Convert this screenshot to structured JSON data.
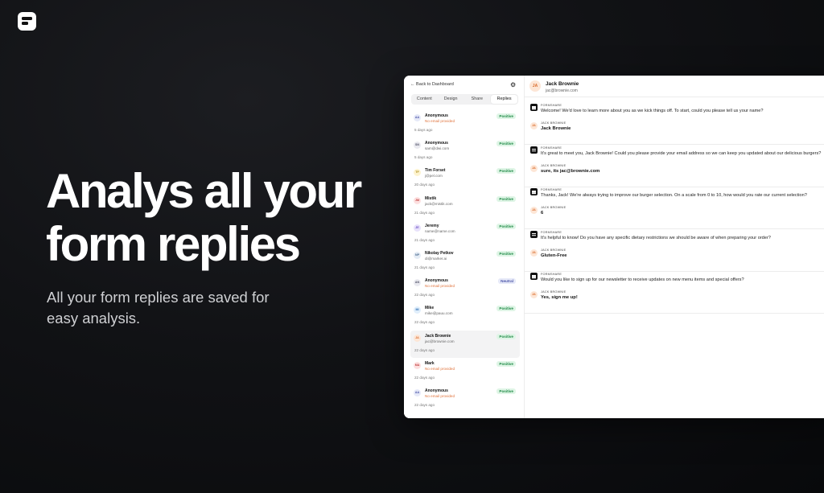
{
  "hero": {
    "headline": "Analys all your form replies",
    "subtitle": "All your form replies are saved for easy analysis."
  },
  "sidebar": {
    "back_label": "Back to Dashboard",
    "tabs": [
      "Content",
      "Design",
      "Share",
      "Replies"
    ],
    "active_tab": "Replies",
    "items": [
      {
        "initials": "AA",
        "name": "Anonymous",
        "email": "No email provided",
        "date": "5 days ago",
        "sentiment": "Positive",
        "color": "#e6e9f8"
      },
      {
        "initials": "SN",
        "name": "Anonymous",
        "email": "sam@dwi.com",
        "date": "5 days ago",
        "sentiment": "Positive",
        "color": "#eaeaf0"
      },
      {
        "initials": "TF",
        "name": "Tim Forset",
        "email": "j@pel.com",
        "date": "20 days ago",
        "sentiment": "Positive",
        "color": "#fdf3cf"
      },
      {
        "initials": "JM",
        "name": "Mistik",
        "email": "jack@mistik.com",
        "date": "21 days ago",
        "sentiment": "Positive",
        "color": "#fde0e0"
      },
      {
        "initials": "JE",
        "name": "Jeremy",
        "email": "name@name.com",
        "date": "21 days ago",
        "sentiment": "Positive",
        "color": "#e8e2fb"
      },
      {
        "initials": "NP",
        "name": "Nikolay Petkov",
        "email": "di@marker.ai",
        "date": "21 days ago",
        "sentiment": "Positive",
        "color": "#e5ecf5"
      },
      {
        "initials": "AN",
        "name": "Anonymous",
        "email": "No email provided",
        "date": "22 days ago",
        "sentiment": "Neutral",
        "color": "#eaeaf0"
      },
      {
        "initials": "MI",
        "name": "Mike",
        "email": "mike@pauu.com",
        "date": "22 days ago",
        "sentiment": "Positive",
        "color": "#e0eefb"
      },
      {
        "initials": "JA",
        "name": "Jack Brownie",
        "email": "jac@brownie.com",
        "date": "22 days ago",
        "sentiment": "Positive",
        "color": "#fde6d6"
      },
      {
        "initials": "MA",
        "name": "Mark",
        "email": "No email provided",
        "date": "22 days ago",
        "sentiment": "Positive",
        "color": "#fde0e0"
      },
      {
        "initials": "AA",
        "name": "Anonymous",
        "email": "No email provided",
        "date": "22 days ago",
        "sentiment": "Positive",
        "color": "#e6e9f8"
      }
    ]
  },
  "detail": {
    "initials": "JA",
    "name": "Jack Brownie",
    "email": "jac@brownie.com",
    "source_label": "FORMSHARE",
    "responder_label": "JACK BROWNIE",
    "blocks": [
      {
        "question": "Welcome! We'd love to learn more about you as we kick things off. To start, could you please tell us your name?",
        "answer": "Jack Brownie"
      },
      {
        "question": "It's great to meet you, Jack Brownie! Could you please provide your email address so we can keep you updated about our delicious burgers?",
        "answer": "sure, its jac@brownie.com"
      },
      {
        "question": "Thanks, Jack! We're always trying to improve our burger selection. On a scale from 0 to 10, how would you rate our current selection?",
        "answer": "6"
      },
      {
        "question": "It's helpful to know! Do you have any specific dietary restrictions we should be aware of when preparing your order?",
        "answer": "Gluten-Free"
      },
      {
        "question": "Would you like to sign up for our newsletter to receive updates on new menu items and special offers?",
        "answer": "Yes, sign me up!"
      }
    ]
  }
}
